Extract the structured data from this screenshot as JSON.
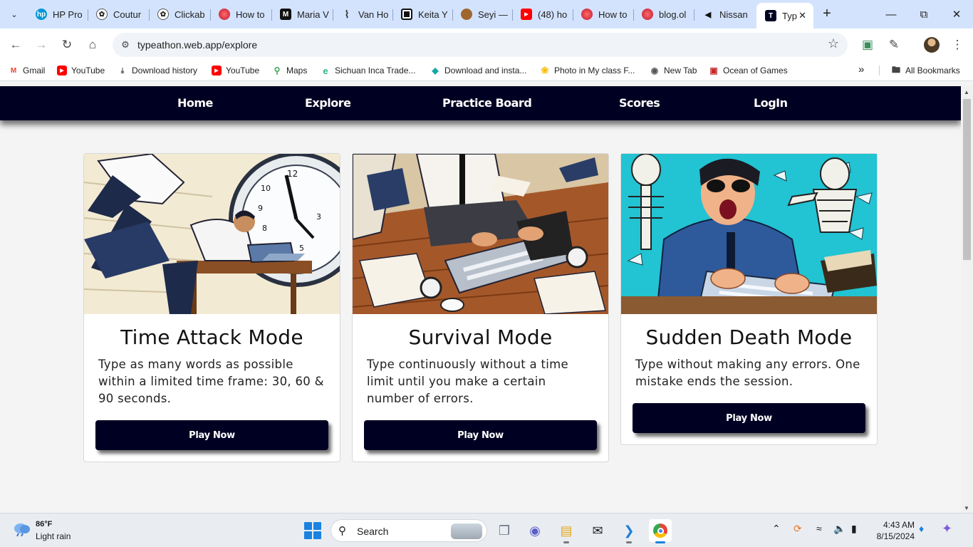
{
  "browser": {
    "tabs": [
      {
        "title": "HP Pro",
        "favicon": "hp-icon",
        "color": "#0096d6"
      },
      {
        "title": "Coutur",
        "favicon": "chatgpt-icon",
        "color": "#1f1f1f"
      },
      {
        "title": "Clickab",
        "favicon": "chatgpt-icon",
        "color": "#1f1f1f"
      },
      {
        "title": "How to",
        "favicon": "opera-icon",
        "color": "#e3242b"
      },
      {
        "title": "Maria V",
        "favicon": "medium-icon",
        "color": "#111111"
      },
      {
        "title": "Van Ho",
        "favicon": "scroll-icon",
        "color": "#333333"
      },
      {
        "title": "Keita Y",
        "favicon": "notion-icon",
        "color": "#111111"
      },
      {
        "title": "Seyi —",
        "favicon": "avatar-icon",
        "color": "#a0662f"
      },
      {
        "title": "(48) ho",
        "favicon": "youtube-icon",
        "color": "#ff0000"
      },
      {
        "title": "How to",
        "favicon": "opera-icon",
        "color": "#e3242b"
      },
      {
        "title": "blog.ol",
        "favicon": "opera-icon",
        "color": "#e3242b"
      },
      {
        "title": "Nissan",
        "favicon": "play-back-icon",
        "color": "#111111"
      },
      {
        "title": "Typ",
        "favicon": "typeathon-icon",
        "color": "#000022",
        "active": true
      }
    ],
    "new_tab_label": "+",
    "url": "typeathon.web.app/explore",
    "bookmarks": [
      {
        "label": "Gmail",
        "icon": "gmail-icon",
        "color": "#ea4335"
      },
      {
        "label": "YouTube",
        "icon": "youtube-icon",
        "color": "#ff0000"
      },
      {
        "label": "Download history",
        "icon": "download-icon",
        "color": "#444444"
      },
      {
        "label": "YouTube",
        "icon": "youtube-icon",
        "color": "#ff0000"
      },
      {
        "label": "Maps",
        "icon": "maps-icon",
        "color": "#34a853"
      },
      {
        "label": "Sichuan Inca Trade...",
        "icon": "edge-icon",
        "color": "#2fb67c"
      },
      {
        "label": "Download and insta...",
        "icon": "diamond-icon",
        "color": "#14a6a6"
      },
      {
        "label": "Photo in My class F...",
        "icon": "photos-icon",
        "color": "#fbbc04"
      },
      {
        "label": "New Tab",
        "icon": "globe-icon",
        "color": "#555555"
      },
      {
        "label": "Ocean of Games",
        "icon": "gamepad-icon",
        "color": "#c62828"
      }
    ],
    "more_bookmarks": "»",
    "all_bookmarks": "All Bookmarks"
  },
  "site": {
    "nav": [
      "Home",
      "Explore",
      "Practice Board",
      "Scores",
      "LogIn"
    ],
    "cards": [
      {
        "title": "Time Attack Mode",
        "description": "Type as many words as possible within a limited time frame: 30, 60 & 90 seconds.",
        "button": "Play Now",
        "theme": "#f3ead3"
      },
      {
        "title": "Survival Mode",
        "description": "Type continuously without a time limit until you make a certain number of errors.",
        "button": "Play Now",
        "theme": "#b5713c"
      },
      {
        "title": "Sudden Death Mode",
        "description": "Type without making any errors. One mistake ends the session.",
        "button": "Play Now",
        "theme": "#22c3d2"
      }
    ]
  },
  "taskbar": {
    "weather_temp": "86°F",
    "weather_desc": "Light rain",
    "search_placeholder": "Search",
    "time": "4:43 AM",
    "date": "8/15/2024"
  }
}
